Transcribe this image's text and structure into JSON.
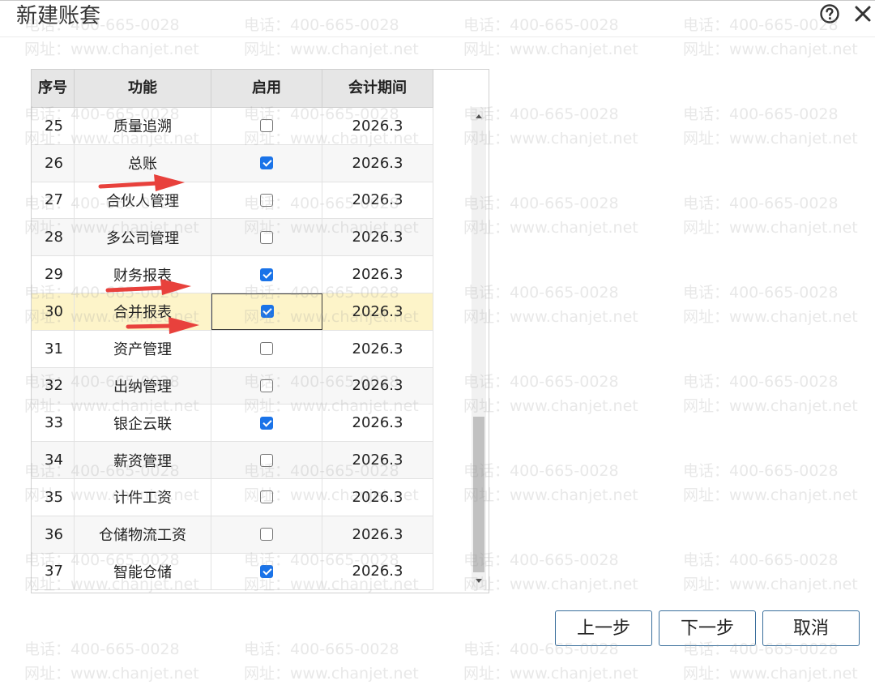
{
  "dialog": {
    "title": "新建账套"
  },
  "icons": {
    "help": "help-circle-icon",
    "close": "close-icon"
  },
  "watermark": {
    "phone": "电话：400-665-0028",
    "site": "网址：www.chanjet.net"
  },
  "table": {
    "columns": [
      "序号",
      "功能",
      "启用",
      "会计期间"
    ],
    "rows": [
      {
        "seq": "25",
        "func": "质量追溯",
        "enabled": false,
        "period": "2026.3"
      },
      {
        "seq": "26",
        "func": "总账",
        "enabled": true,
        "period": "2026.3"
      },
      {
        "seq": "27",
        "func": "合伙人管理",
        "enabled": false,
        "period": "2026.3"
      },
      {
        "seq": "28",
        "func": "多公司管理",
        "enabled": false,
        "period": "2026.3"
      },
      {
        "seq": "29",
        "func": "财务报表",
        "enabled": true,
        "period": "2026.3"
      },
      {
        "seq": "30",
        "func": "合并报表",
        "enabled": true,
        "period": "2026.3"
      },
      {
        "seq": "31",
        "func": "资产管理",
        "enabled": false,
        "period": "2026.3"
      },
      {
        "seq": "32",
        "func": "出纳管理",
        "enabled": false,
        "period": "2026.3"
      },
      {
        "seq": "33",
        "func": "银企云联",
        "enabled": true,
        "period": "2026.3"
      },
      {
        "seq": "34",
        "func": "薪资管理",
        "enabled": false,
        "period": "2026.3"
      },
      {
        "seq": "35",
        "func": "计件工资",
        "enabled": false,
        "period": "2026.3"
      },
      {
        "seq": "36",
        "func": "仓储物流工资",
        "enabled": false,
        "period": "2026.3"
      },
      {
        "seq": "37",
        "func": "智能仓储",
        "enabled": true,
        "period": "2026.3"
      }
    ],
    "selected_seq": "30"
  },
  "buttons": {
    "prev": "上一步",
    "next": "下一步",
    "cancel": "取消"
  },
  "colors": {
    "accent": "#1a73e8",
    "selected_row": "#fdf4c9",
    "annotation_arrow": "#e8413c",
    "button_border": "#3a6f9c"
  }
}
